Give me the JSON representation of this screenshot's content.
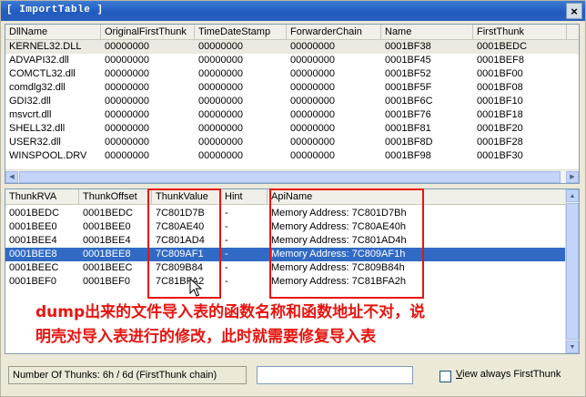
{
  "window": {
    "title": "[ ImportTable ]",
    "close_glyph": "×"
  },
  "top_table": {
    "columns": [
      "DllName",
      "OriginalFirstThunk",
      "TimeDateStamp",
      "ForwarderChain",
      "Name",
      "FirstThunk"
    ],
    "rows": [
      [
        "KERNEL32.DLL",
        "00000000",
        "00000000",
        "00000000",
        "0001BF38",
        "0001BEDC"
      ],
      [
        "ADVAPI32.dll",
        "00000000",
        "00000000",
        "00000000",
        "0001BF45",
        "0001BEF8"
      ],
      [
        "COMCTL32.dll",
        "00000000",
        "00000000",
        "00000000",
        "0001BF52",
        "0001BF00"
      ],
      [
        "comdlg32.dll",
        "00000000",
        "00000000",
        "00000000",
        "0001BF5F",
        "0001BF08"
      ],
      [
        "GDI32.dll",
        "00000000",
        "00000000",
        "00000000",
        "0001BF6C",
        "0001BF10"
      ],
      [
        "msvcrt.dll",
        "00000000",
        "00000000",
        "00000000",
        "0001BF76",
        "0001BF18"
      ],
      [
        "SHELL32.dll",
        "00000000",
        "00000000",
        "00000000",
        "0001BF81",
        "0001BF20"
      ],
      [
        "USER32.dll",
        "00000000",
        "00000000",
        "00000000",
        "0001BF8D",
        "0001BF28"
      ],
      [
        "WINSPOOL.DRV",
        "00000000",
        "00000000",
        "00000000",
        "0001BF98",
        "0001BF30"
      ]
    ]
  },
  "bottom_table": {
    "columns": [
      "ThunkRVA",
      "ThunkOffset",
      "ThunkValue",
      "Hint",
      "ApiName"
    ],
    "rows": [
      [
        "0001BEDC",
        "0001BEDC",
        "7C801D7B",
        "-",
        "Memory Address:  7C801D7Bh"
      ],
      [
        "0001BEE0",
        "0001BEE0",
        "7C80AE40",
        "-",
        "Memory Address:  7C80AE40h"
      ],
      [
        "0001BEE4",
        "0001BEE4",
        "7C801AD4",
        "-",
        "Memory Address:  7C801AD4h"
      ],
      [
        "0001BEE8",
        "0001BEE8",
        "7C809AF1",
        "-",
        "Memory Address:  7C809AF1h"
      ],
      [
        "0001BEEC",
        "0001BEEC",
        "7C809B84",
        "-",
        "Memory Address:  7C809B84h"
      ],
      [
        "0001BEF0",
        "0001BEF0",
        "7C81BFA2",
        "-",
        "Memory Address:  7C81BFA2h"
      ]
    ],
    "selected_row": 3
  },
  "annotation": {
    "line1": "dump出来的文件导入表的函数名称和函数地址不对，说",
    "line2": "明壳对导入表进行的修改，此时就需要修复导入表"
  },
  "status": {
    "thunks_text": "Number Of Thunks: 6h / 6d (FirstThunk chain)",
    "textbox_value": "",
    "checkbox_label_underlined": "V",
    "checkbox_label_rest": "iew always FirstThunk",
    "checkbox_checked": false
  },
  "colors": {
    "annotation_red": "#e8140f",
    "selection_blue": "#316ac5",
    "titlebar_blue": "#215bbf"
  }
}
